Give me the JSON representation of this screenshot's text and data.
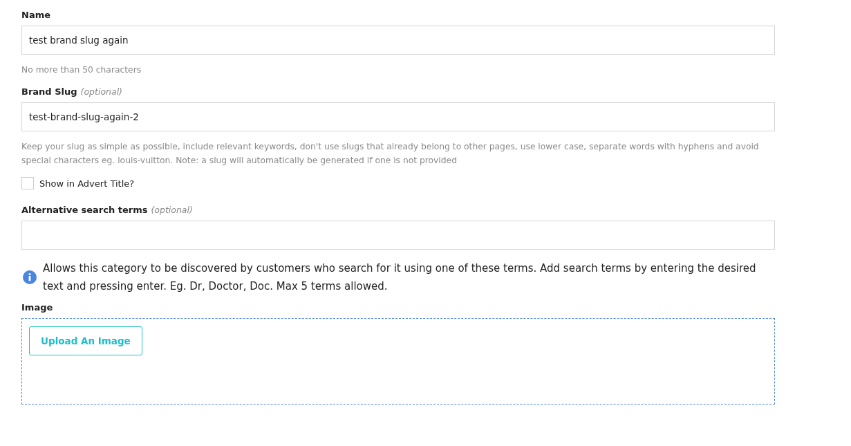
{
  "name_field": {
    "label": "Name",
    "value": "test brand slug again",
    "help": "No more than 50 characters"
  },
  "slug_field": {
    "label": "Brand Slug",
    "optional": "(optional)",
    "value": "test-brand-slug-again-2",
    "help": "Keep your slug as simple as possible, include relevant keywords, don't use slugs that already belong to other pages, use lower case, separate words with hyphens and avoid special characters eg. louis-vuitton. Note: a slug will automatically be generated if one is not provided"
  },
  "show_in_advert_title": {
    "label": "Show in Advert Title?",
    "checked": false
  },
  "search_terms_field": {
    "label": "Alternative search terms",
    "optional": "(optional)",
    "info": "Allows this category to be discovered by customers who search for it using one of these terms. Add search terms by entering the desired text and pressing enter. Eg. Dr, Doctor, Doc. Max 5 terms allowed."
  },
  "image": {
    "label": "Image",
    "button": "Upload An Image"
  }
}
